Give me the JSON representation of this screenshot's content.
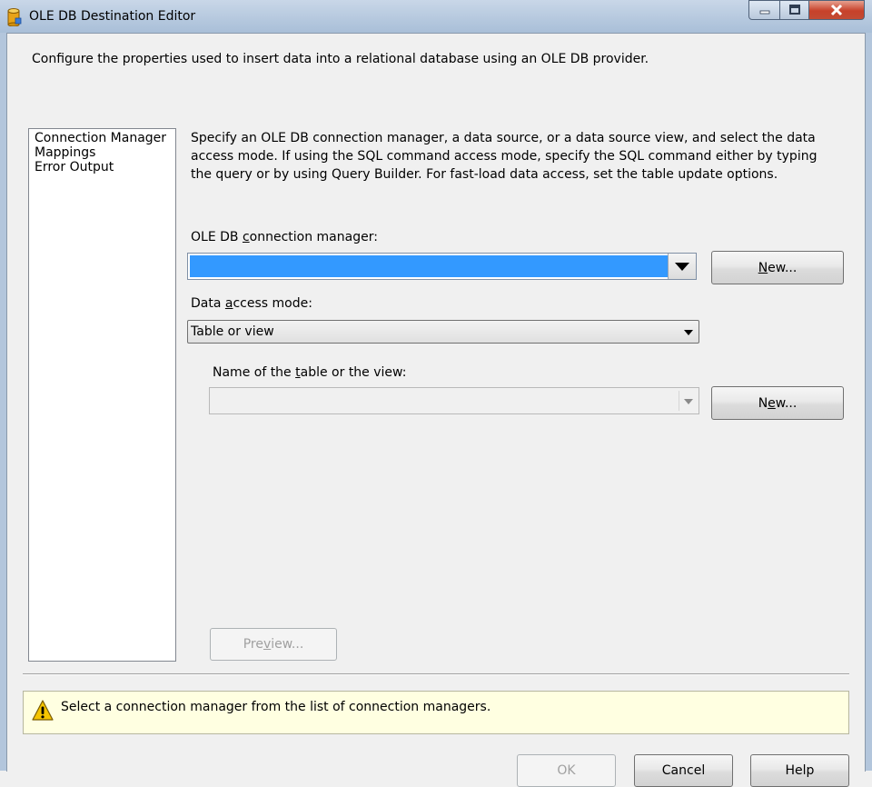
{
  "window": {
    "title": "OLE DB Destination Editor",
    "icon": "database-cylinder-icon",
    "controls": [
      "minimize-icon",
      "maximize-icon",
      "close-icon"
    ]
  },
  "header": {
    "text": "Configure the properties used to insert data into a relational database using an OLE DB provider."
  },
  "nav": {
    "items": [
      {
        "label": "Connection Manager"
      },
      {
        "label": "Mappings"
      },
      {
        "label": "Error Output"
      }
    ]
  },
  "main": {
    "description": "Specify an OLE DB connection manager, a data source, or a data source view, and select the data access mode. If using the SQL command access mode, specify the SQL command either by typing the query or by using Query Builder. For fast-load data access, set the table update options.",
    "conn_label": {
      "pre": "OLE DB ",
      "u": "c",
      "post": "onnection manager:"
    },
    "conn_value": "",
    "conn_new_button": {
      "u": "N",
      "post": "ew..."
    },
    "mode_label": {
      "pre": "Data ",
      "u": "a",
      "post": "ccess mode:"
    },
    "mode_value": "Table or view",
    "table_label": {
      "pre": "Name of the ",
      "u": "t",
      "post": "able or the view:"
    },
    "table_value": "",
    "table_new_button": {
      "pre": "N",
      "u": "e",
      "post": "w..."
    },
    "preview_button": {
      "pre": "Pre",
      "u": "v",
      "post": "iew..."
    }
  },
  "message": {
    "icon": "warning-icon",
    "text": "Select a connection manager from the list of connection managers."
  },
  "footer": {
    "ok": "OK",
    "cancel": "Cancel",
    "help": "Help"
  },
  "colors": {
    "selection": "#3399ff",
    "message_bg": "#ffffe1",
    "close_button": "#c7412a"
  }
}
